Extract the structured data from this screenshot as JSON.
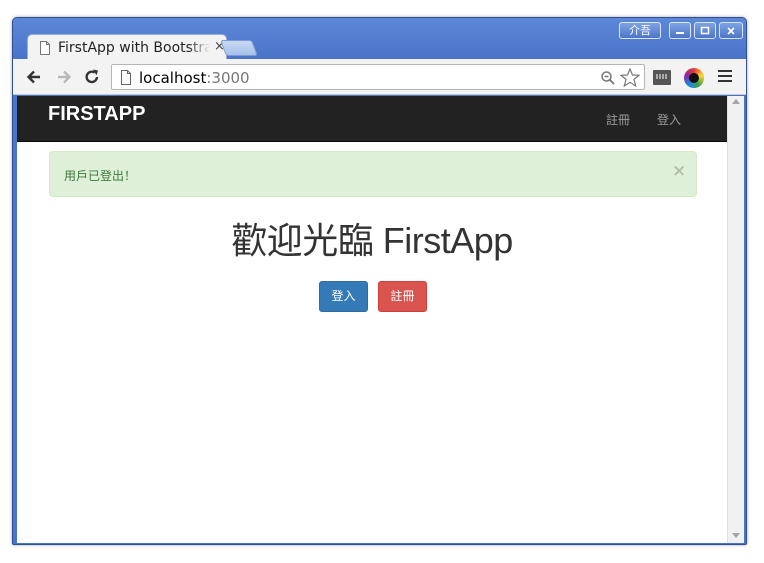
{
  "browser": {
    "tab_title": "FirstApp with Bootstrap",
    "tab_close": "×",
    "ime_label": "介吾",
    "url_host": "localhost",
    "url_port": ":3000"
  },
  "page": {
    "brand": "FIRSTAPP",
    "nav": {
      "signup": "註冊",
      "login": "登入"
    },
    "alert": {
      "message": "用戶已登出！",
      "close": "×"
    },
    "heading": "歡迎光臨 FirstApp",
    "buttons": {
      "login": "登入",
      "signup": "註冊"
    }
  },
  "colors": {
    "navbar_bg": "#222222",
    "alert_bg": "#dff0d8",
    "alert_text": "#3c763d",
    "primary": "#337ab7",
    "danger": "#d9534f"
  }
}
